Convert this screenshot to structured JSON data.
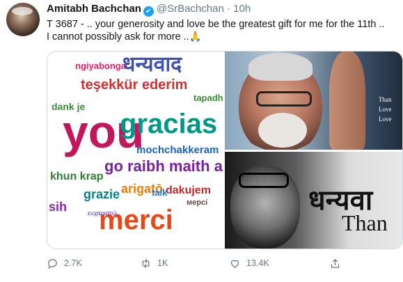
{
  "tweet": {
    "author_name": "Amitabh Bachchan",
    "verified_mark": "✔",
    "handle": "@SrBachchan",
    "separator": "·",
    "time": "10h",
    "text_line1": "T 3687 - .. your generosity and love be the greatest gift for me for the 11th  ..",
    "text_line2": "I cannot possibly ask for more  ..🙏"
  },
  "media": {
    "word_cloud": {
      "words": [
        {
          "text": "ngiyabonga",
          "color": "#e91e63"
        },
        {
          "text": "धन्यवाद",
          "color": "#3f51b5"
        },
        {
          "text": "teşekkür ederim",
          "color": "#d32f2f"
        },
        {
          "text": "dank je",
          "color": "#388e3c"
        },
        {
          "text": "you",
          "color": "#c2185b"
        },
        {
          "text": "gracias",
          "color": "#009688"
        },
        {
          "text": "mochchakkeram",
          "color": "#1565c0"
        },
        {
          "text": "go raibh maith agat",
          "color": "#7b1fa2"
        },
        {
          "text": "khun krap",
          "color": "#2e7d32"
        },
        {
          "text": "arigatō",
          "color": "#f57c00"
        },
        {
          "text": "dakujem",
          "color": "#c62828"
        },
        {
          "text": "grazie",
          "color": "#00838f"
        },
        {
          "text": "merci",
          "color": "#e64a19"
        },
        {
          "text": "talk",
          "color": "#1976d2"
        },
        {
          "text": "tapadh leat",
          "color": "#388e3c"
        },
        {
          "text": "sih",
          "color": "#8e24aa"
        },
        {
          "text": "мерсі",
          "color": "#6d4c41"
        },
        {
          "text": "ευχαριστώ",
          "color": "#5e35b1"
        }
      ]
    },
    "top_right_text": [
      "Than",
      "Love",
      "Love"
    ],
    "bottom_right_text": {
      "hindi": "धन्यवा",
      "english": "Than"
    }
  },
  "actions": {
    "reply_count": "2.7K",
    "retweet_count": "1K",
    "like_count": "13.4K"
  }
}
